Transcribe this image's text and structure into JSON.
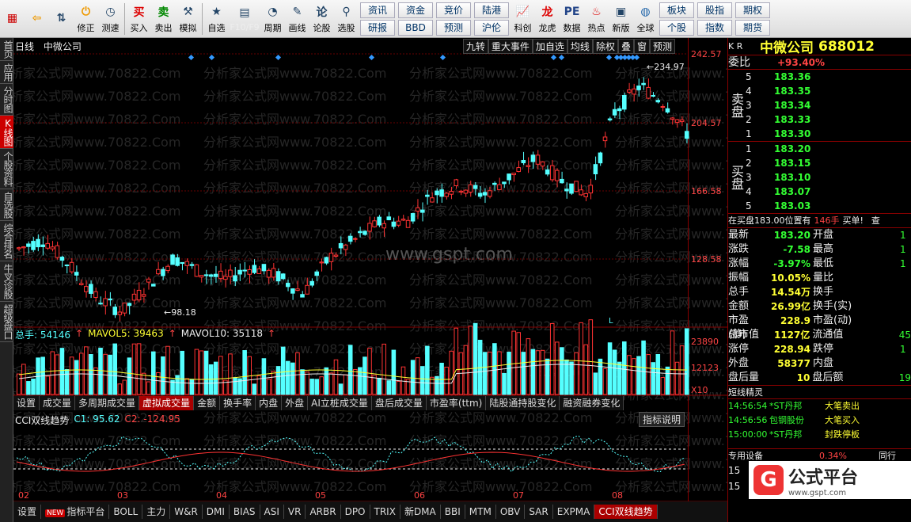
{
  "toolbar": {
    "buttons": [
      {
        "label": "",
        "icon": "app-grid-icon"
      },
      {
        "label": "",
        "icon": "back-arrow-icon"
      },
      {
        "label": "",
        "icon": "up-down-arrow-icon"
      },
      {
        "label": "修正",
        "icon": "power-icon"
      },
      {
        "label": "测速",
        "icon": "clock-icon"
      },
      {
        "label": "买入",
        "icon": "buy-icon"
      },
      {
        "label": "卖出",
        "icon": "sell-icon"
      },
      {
        "label": "模拟",
        "icon": "hammer-icon"
      },
      {
        "label": "自选",
        "icon": "star-folder-icon"
      },
      {
        "label": "F10/F9",
        "icon": "f10-icon"
      },
      {
        "label": "周期",
        "icon": "period-icon"
      },
      {
        "label": "画线",
        "icon": "pencil-icon"
      },
      {
        "label": "论股",
        "icon": "chat-icon"
      },
      {
        "label": "选股",
        "icon": "magnifier-icon"
      }
    ],
    "text_buttons": [
      [
        "资讯",
        "研报"
      ],
      [
        "资金",
        "BBD"
      ],
      [
        "竞价",
        "预测"
      ],
      [
        "陆港",
        "沪伦"
      ]
    ],
    "buttons2": [
      {
        "label": "科创",
        "icon": "chart-icon"
      },
      {
        "label": "龙虎",
        "icon": "dragon-icon"
      },
      {
        "label": "数据",
        "icon": "pe-icon"
      },
      {
        "label": "热点",
        "icon": "fire-icon"
      },
      {
        "label": "新版",
        "icon": "window-icon"
      },
      {
        "label": "全球",
        "icon": "globe-icon"
      }
    ],
    "text_buttons2": [
      [
        "板块",
        "个股"
      ],
      [
        "股指",
        "指数"
      ],
      [
        "期权",
        "期货"
      ]
    ]
  },
  "leftnav": [
    "首页",
    "应用",
    "分时图",
    "K线图",
    "个股资料",
    "自选股",
    "综合排名",
    "牛叉诊股",
    "超级盘口"
  ],
  "leftnav_active": 3,
  "chart": {
    "title_left": "日线",
    "stock_name": "中微公司",
    "top_menu": [
      "九转",
      "重大事件",
      "加自选",
      "均线",
      "除权",
      "叠",
      "窗",
      "预测"
    ],
    "price_ticks": [
      "242.57",
      "204.57",
      "166.58",
      "128.58"
    ],
    "high_label": "234.97",
    "low_label": "98.18",
    "l_marker": "L",
    "vol_line": {
      "label": "总手: 54146",
      "ma5": "MAVOL5: 39463",
      "ma10": "MAVOL10: 35118"
    },
    "vol_ticks": [
      "23890",
      "12123"
    ],
    "vol_unit": "X10",
    "ind_tabs": [
      "设置",
      "成交量",
      "多周期成交量",
      "虚拟成交量",
      "金额",
      "换手率",
      "内盘",
      "外盘",
      "AI立桩成交量",
      "盘后成交量",
      "市盈率(ttm)",
      "陆股通持股变化",
      "融资融券变化"
    ],
    "ind_tab_active": 3,
    "cci_line": {
      "name": "CCI双线趋势",
      "c1": "C1: 95.62",
      "c2": "C2: -124.95"
    },
    "ind_explain": "指标说明",
    "x_ticks": [
      "02",
      "03",
      "04",
      "05",
      "06",
      "07",
      "08"
    ],
    "watermark": "分析家公式网www.70822.Com",
    "watermark2": "www.gspt.com"
  },
  "bottom_tabs": [
    "设置",
    "指标平台",
    "BOLL",
    "主力",
    "W&R",
    "DMI",
    "BIAS",
    "ASI",
    "VR",
    "ARBR",
    "DPO",
    "TRIX",
    "新DMA",
    "BBI",
    "MTM",
    "OBV",
    "SAR",
    "EXPMA",
    "CCI双线趋势"
  ],
  "bottom_new": "NEW",
  "bottom_active": 18,
  "info": {
    "kr": "K R",
    "name": "中微公司",
    "code": "688012",
    "weibi_label": "委比",
    "weibi": "+93.40%",
    "sell": [
      {
        "n": "5",
        "p": "183.36"
      },
      {
        "n": "4",
        "p": "183.35"
      },
      {
        "n": "3",
        "p": "183.34"
      },
      {
        "n": "2",
        "p": "183.33"
      },
      {
        "n": "1",
        "p": "183.30"
      }
    ],
    "buy": [
      {
        "n": "1",
        "p": "183.20"
      },
      {
        "n": "2",
        "p": "183.15"
      },
      {
        "n": "3",
        "p": "183.10"
      },
      {
        "n": "4",
        "p": "183.07"
      },
      {
        "n": "5",
        "p": "183.03"
      }
    ],
    "sell_label": "卖盘",
    "buy_label": "买盘",
    "bidline": "在买盘183.00位置有",
    "bidqty": "146手",
    "bidtail": "买单!",
    "bidbtn": "查",
    "stats": [
      [
        "最新",
        "183.20",
        "开盘",
        "1"
      ],
      [
        "涨跌",
        "-7.58",
        "最高",
        "1"
      ],
      [
        "涨幅",
        "-3.97%",
        "最低",
        "1"
      ],
      [
        "振幅",
        "10.05%",
        "量比",
        ""
      ],
      [
        "总手",
        "14.54万",
        "换手",
        ""
      ],
      [
        "金额",
        "26.99亿",
        "换手(实)",
        ""
      ],
      [
        "市盈(静)",
        "228.9",
        "市盈(动)",
        ""
      ],
      [
        "总市值",
        "1127亿",
        "流通值",
        "45"
      ],
      [
        "涨停",
        "228.94",
        "跌停",
        "1"
      ],
      [
        "外盘",
        "58377",
        "内盘",
        ""
      ],
      [
        "盘后量",
        "10",
        "盘后额",
        "19"
      ]
    ],
    "jingling": "短线精灵",
    "events": [
      [
        "14:56:54",
        "*ST丹邦",
        "大笔卖出"
      ],
      [
        "14:56:56",
        "包钢股份",
        "大笔买入"
      ],
      [
        "15:00:00",
        "*ST丹邦",
        "封跌停板"
      ]
    ],
    "zhuanyong": "专用设备",
    "zy_pct": "0.34%",
    "tonghang": "同行",
    "bottom_nums": [
      "15",
      "15"
    ],
    "logo_text": "公式平台",
    "logo_url": "www.gspt.com"
  },
  "chart_data": {
    "type": "candlestick",
    "price_range": [
      98.18,
      242.57
    ],
    "labels": [
      "02",
      "03",
      "04",
      "05",
      "06",
      "07",
      "08"
    ],
    "notes": "K-line daily chart of 中微公司 (688012), high 234.97, low 98.18"
  }
}
